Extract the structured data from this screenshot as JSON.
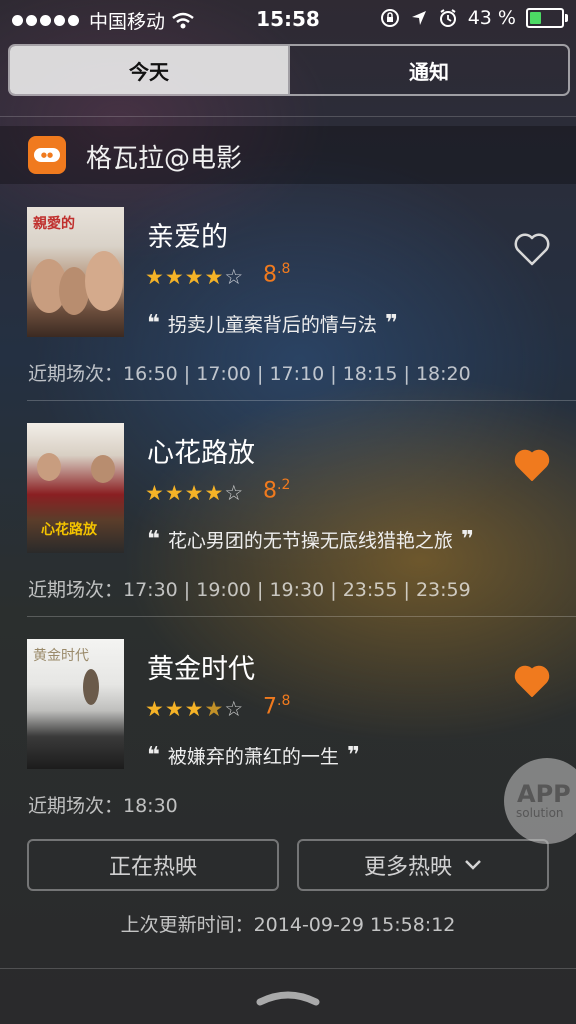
{
  "status_bar": {
    "carrier": "中国移动",
    "time": "15:58",
    "battery_percent": "43 %",
    "battery_level": 0.43,
    "signal_dots": 5,
    "icons": [
      "wifi-icon",
      "rotation-lock-icon",
      "location-arrow-icon",
      "alarm-icon",
      "battery-icon"
    ]
  },
  "tabs": [
    {
      "label": "今天",
      "active": true
    },
    {
      "label": "通知",
      "active": false
    }
  ],
  "widget": {
    "app_name": "格瓦拉@电影",
    "icon": "gewara-logo"
  },
  "movies": [
    {
      "title": "亲爱的",
      "poster_text": "親愛的",
      "rating_stars": 4,
      "score_main": "8",
      "score_decimal": ".8",
      "quote": "拐卖儿童案背后的情与法",
      "favorited": false,
      "showtimes": "近期场次：16:50 | 17:00 | 17:10 | 18:15 | 18:20"
    },
    {
      "title": "心花路放",
      "poster_text": "心花路放",
      "rating_stars": 4,
      "score_main": "8",
      "score_decimal": ".2",
      "quote": "花心男团的无节操无底线猎艳之旅",
      "favorited": true,
      "showtimes": "近期场次：17:30 | 19:00 | 19:30 | 23:55 | 23:59"
    },
    {
      "title": "黄金时代",
      "poster_text": "黄金时代",
      "rating_stars": 3.5,
      "score_main": "7",
      "score_decimal": ".8",
      "quote": "被嫌弃的萧红的一生",
      "favorited": true,
      "showtimes": "近期场次：18:30"
    }
  ],
  "buttons": {
    "now_showing": "正在热映",
    "more_showing": "更多热映"
  },
  "last_updated": "上次更新时间：2014-09-29 15:58:12",
  "watermark": {
    "big": "APP",
    "small": "solution"
  },
  "colors": {
    "accent": "#f07a1e",
    "star": "#f5b327",
    "battery": "#4cd964"
  }
}
